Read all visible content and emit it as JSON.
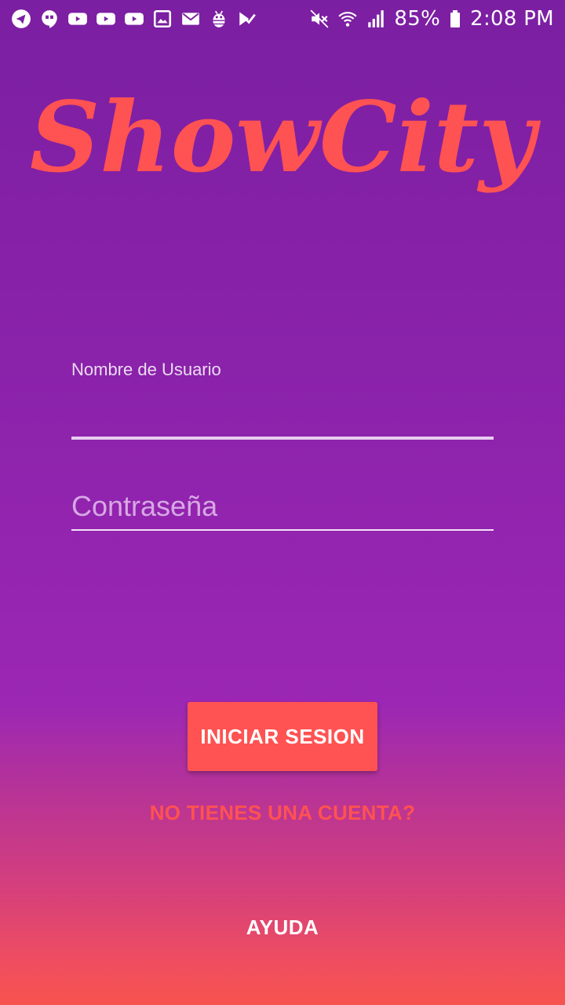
{
  "status_bar": {
    "notification_icons": [
      "telegram-icon",
      "hangouts-icon",
      "youtube-icon",
      "youtube-icon",
      "youtube-icon",
      "gallery-icon",
      "email-icon",
      "android-debug-icon",
      "checklist-icon"
    ],
    "battery_percent": "85%",
    "time": "2:08 PM"
  },
  "logo": {
    "text": "ShowCity",
    "color": "#ff5252"
  },
  "form": {
    "username_label": "Nombre de Usuario",
    "username_value": "",
    "password_placeholder": "Contraseña",
    "password_value": ""
  },
  "actions": {
    "login_label": "INICIAR SESION",
    "signup_label": "NO TIENES UNA CUENTA?",
    "help_label": "AYUDA"
  },
  "colors": {
    "accent": "#ff5252",
    "background_top": "#7b1fa2",
    "background_bottom": "#f7534f"
  }
}
